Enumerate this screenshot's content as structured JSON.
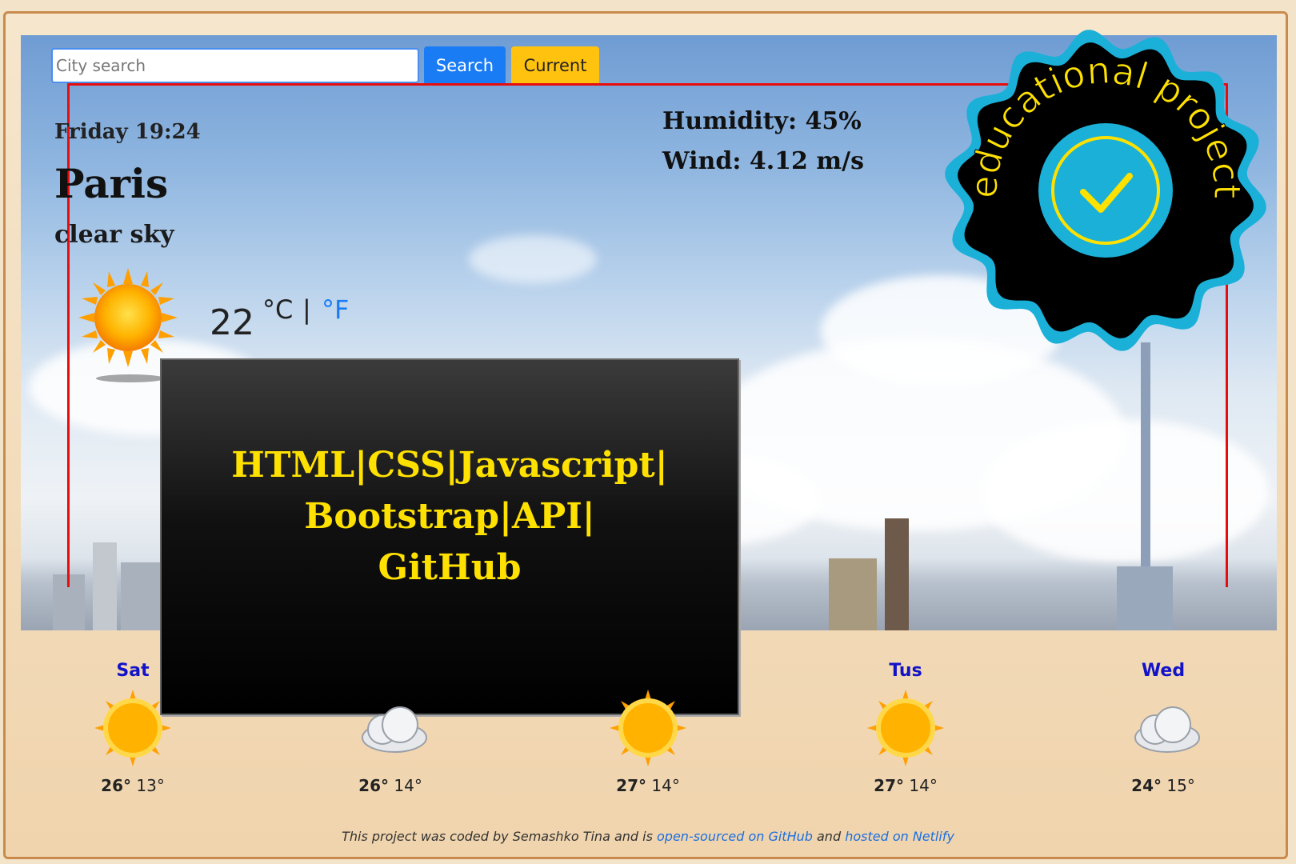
{
  "search": {
    "placeholder": "City search",
    "button_label": "Search",
    "current_label": "Current"
  },
  "current": {
    "datetime": "Friday 19:24",
    "city": "Paris",
    "description": "clear sky",
    "temperature": "22",
    "unit_celsius": "°C",
    "unit_separator": "|",
    "unit_fahrenheit": "°F",
    "humidity": "Humidity: 45%",
    "wind": "Wind: 4.12 m/s",
    "icon": "sun-icon"
  },
  "overlay": {
    "line1": "HTML|CSS|Javascript|",
    "line2": "Bootstrap|API|",
    "line3": "GitHub"
  },
  "badge": {
    "text": "educational project",
    "icon": "checkmark-icon"
  },
  "forecast": [
    {
      "day": "Sat",
      "icon": "sun-icon",
      "max": "26°",
      "min": "13°"
    },
    {
      "day": "",
      "icon": "cloud-icon",
      "max": "26°",
      "min": "14°"
    },
    {
      "day": "",
      "icon": "sun-icon",
      "max": "27°",
      "min": "14°"
    },
    {
      "day": "Tus",
      "icon": "sun-icon",
      "max": "27°",
      "min": "14°"
    },
    {
      "day": "Wed",
      "icon": "cloud-icon",
      "max": "24°",
      "min": "15°"
    }
  ],
  "footer": {
    "prefix": "This project was coded by Semashko Tina and is ",
    "github_link": "open-sourced on GitHub",
    "middle": " and ",
    "netlify_link": "hosted on Netlify"
  },
  "colors": {
    "accent": "#1a7cf5",
    "current_button": "#ffc20e",
    "overlay_text": "#ffe100",
    "highlight_box": "#e80d0d",
    "badge_ring": "#1ab0d8"
  }
}
